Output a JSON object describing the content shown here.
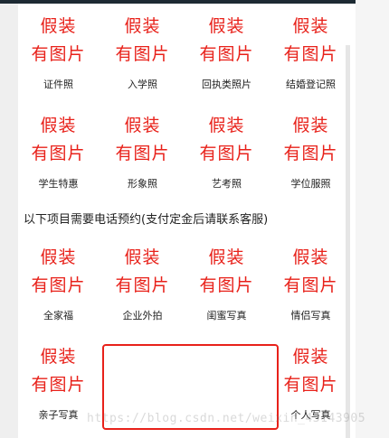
{
  "placeholder_line1": "假装",
  "placeholder_line2": "有图片",
  "row1": [
    "证件照",
    "入学照",
    "回执类照片",
    "结婚登记照"
  ],
  "row2": [
    "学生特惠",
    "形象照",
    "艺考照",
    "学位服照"
  ],
  "section_note": "以下项目需要电话预约(支付定金后请联系客服)",
  "row3": [
    "全家福",
    "企业外拍",
    "闺蜜写真",
    "情侣写真"
  ],
  "row4_left": "亲子写真",
  "row4_right": "个人写真",
  "watermark": "https://blog.csdn.net/weixin_43143905",
  "colors": {
    "accent": "#e8211a"
  }
}
